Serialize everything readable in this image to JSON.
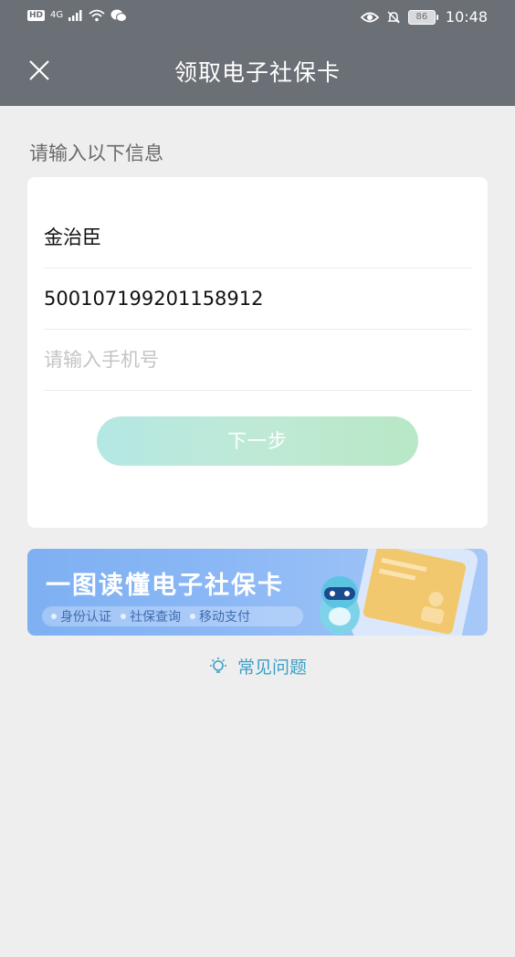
{
  "status_bar": {
    "hd": "HD",
    "network": "4G",
    "battery": "86",
    "time": "10:48"
  },
  "nav": {
    "title": "领取电子社保卡"
  },
  "form": {
    "section_label": "请输入以下信息",
    "name_value": "金治臣",
    "id_value": "500107199201158912",
    "phone_placeholder": "请输入手机号",
    "next_label": "下一步"
  },
  "banner": {
    "title": "一图读懂电子社保卡",
    "tags": [
      "身份认证",
      "社保查询",
      "移动支付"
    ]
  },
  "faq": {
    "label": "常见问题"
  },
  "colors": {
    "nav_bg": "#6b6f76",
    "page_bg": "#eeeeee",
    "faq_accent": "#3aa0c8"
  }
}
